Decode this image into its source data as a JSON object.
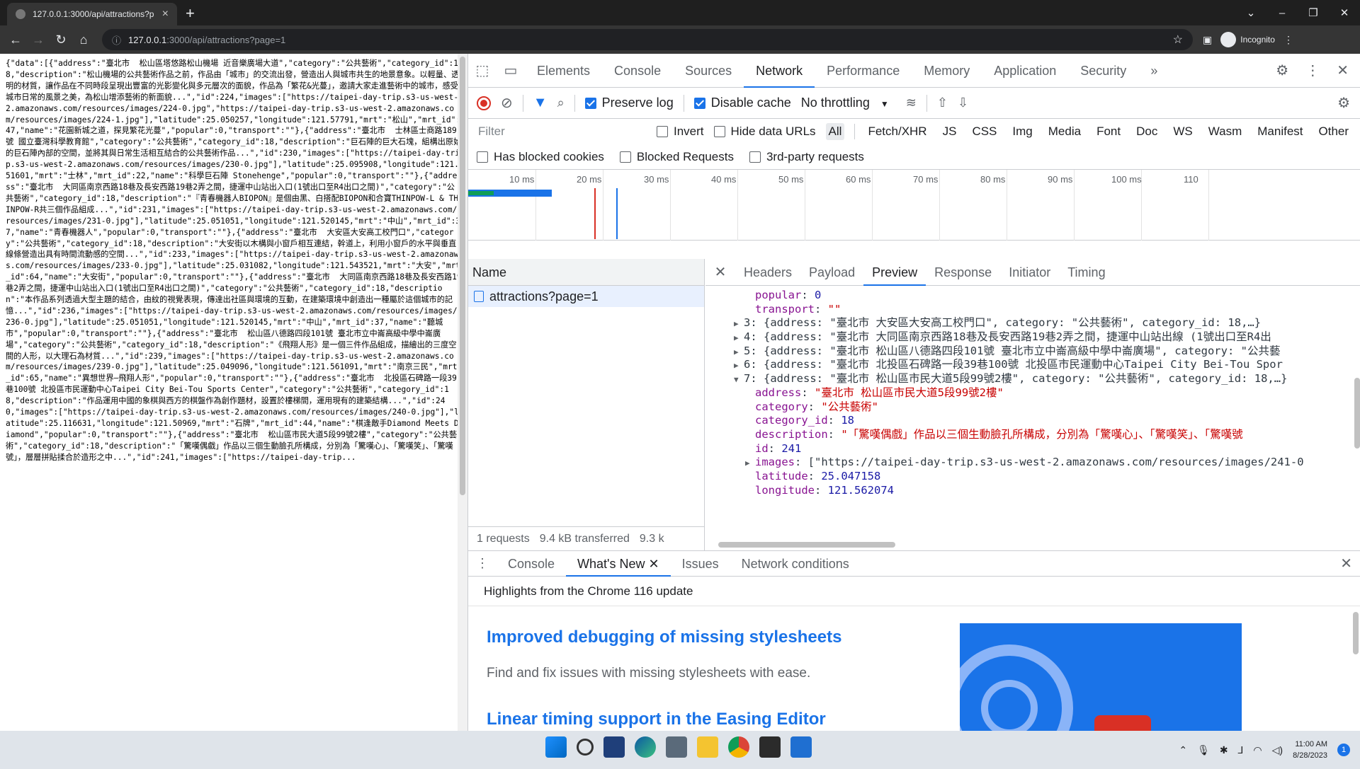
{
  "browser": {
    "tab_title": "127.0.0.1:3000/api/attractions?p",
    "url_host": "127.0.0.1",
    "url_path": ":3000/api/attractions?page=1",
    "profile_label": "Incognito"
  },
  "page": {
    "json_text": "{\"data\":[{\"address\":\"臺北市  松山區塔悠路松山機場 近音樂廣場大道\",\"category\":\"公共藝術\",\"category_id\":18,\"description\":\"松山機場的公共藝術作品之前，作品由「城市」的交流出發，營造出人與城市共生的地景意象。以輕量、透明的材質，讓作品在不同時段呈現出豐富的光影變化與多元層次的面貌，作品為「繁花&光蔓」，邀請大家走進藝術中的城市，感受城市日常的風景之美，為松山增添藝術的新面貌...\",\"id\":224,\"images\":[\"https://taipei-day-trip.s3-us-west-2.amazonaws.com/resources/images/224-0.jpg\",\"https://taipei-day-trip.s3-us-west-2.amazonaws.com/resources/images/224-1.jpg\"],\"latitude\":25.050257,\"longitude\":121.57791,\"mrt\":\"松山\",\"mrt_id\":47,\"name\":\"花園新城之道，探見繁花光蔓\",\"popular\":0,\"transport\":\"\"},{\"address\":\"臺北市  士林區士商路189號 國立臺灣科學教育館\",\"category\":\"公共藝術\",\"category_id\":18,\"description\":\"巨石陣的巨大石塊，組構出原始的巨石陣內部的空間，並將其與日常生活相互結合的公共藝術作品...\",\"id\":230,\"images\":[\"https://taipei-day-trip.s3-us-west-2.amazonaws.com/resources/images/230-0.jpg\"],\"latitude\":25.095908,\"longitude\":121.51601,\"mrt\":\"士林\",\"mrt_id\":22,\"name\":\"科學巨石陣 Stonehenge\",\"popular\":0,\"transport\":\"\"},{\"address\":\"臺北市  大同區南京西路18巷及長安西路19巷2弄之間，捷運中山站出入口(1號出口至R4出口之間)\",\"category\":\"公共藝術\",\"category_id\":18,\"description\":\"『青春機器人BIOPON』是個由黑、白搭配BIOPON和合寶THINPOW-L & THINPOW-R共三個作品組成...\",\"id\":231,\"images\":[\"https://taipei-day-trip.s3-us-west-2.amazonaws.com/resources/images/231-0.jpg\"],\"latitude\":25.051051,\"longitude\":121.520145,\"mrt\":\"中山\",\"mrt_id\":37,\"name\":\"青春機器人\",\"popular\":0,\"transport\":\"\"},{\"address\":\"臺北市  大安區大安高工校門口\",\"category\":\"公共藝術\",\"category_id\":18,\"description\":\"大安街以木構與小窗戶相互連結，幹道上，利用小窗戶的水平與垂直線條營造出具有時間流動感的空間...\",\"id\":233,\"images\":[\"https://taipei-day-trip.s3-us-west-2.amazonaws.com/resources/images/233-0.jpg\"],\"latitude\":25.031082,\"longitude\":121.543521,\"mrt\":\"大安\",\"mrt_id\":64,\"name\":\"大安街\",\"popular\":0,\"transport\":\"\"},{\"address\":\"臺北市  大同區南京西路18巷及長安西路19巷2弄之間，捷運中山站出入口(1號出口至R4出口之間)\",\"category\":\"公共藝術\",\"category_id\":18,\"description\":\"本作品系列透過大型主題的結合，由紋的視覺表現，傳達出社區與環境的互動，在建築環境中創造出一種屬於這個城市的記憶...\",\"id\":236,\"images\":[\"https://taipei-day-trip.s3-us-west-2.amazonaws.com/resources/images/236-0.jpg\"],\"latitude\":25.051051,\"longitude\":121.520145,\"mrt\":\"中山\",\"mrt_id\":37,\"name\":\"聽城市\",\"popular\":0,\"transport\":\"\"},{\"address\":\"臺北市  松山區八德路四段101號 臺北市立中崙高級中學中崙廣場\",\"category\":\"公共藝術\",\"category_id\":18,\"description\":\"《飛翔人形》是一個三件作品組成，描繪出的三度空間的人形，以大理石為材質...\",\"id\":239,\"images\":[\"https://taipei-day-trip.s3-us-west-2.amazonaws.com/resources/images/239-0.jpg\"],\"latitude\":25.049096,\"longitude\":121.561091,\"mrt\":\"南京三民\",\"mrt_id\":65,\"name\":\"異想世界—飛翔人形\",\"popular\":0,\"transport\":\"\"},{\"address\":\"臺北市  北投區石碑路一段39巷100號 北投區市民運動中心Taipei City Bei-Tou Sports Center\",\"category\":\"公共藝術\",\"category_id\":18,\"description\":\"作品運用中國的象棋與西方的棋盤作為創作題材，設置於樓梯間，運用現有的建築結構...\",\"id\":240,\"images\":[\"https://taipei-day-trip.s3-us-west-2.amazonaws.com/resources/images/240-0.jpg\"],\"latitude\":25.116631,\"longitude\":121.50969,\"mrt\":\"石牌\",\"mrt_id\":44,\"name\":\"棋逢敵手Diamond Meets Diamond\",\"popular\":0,\"transport\":\"\"},{\"address\":\"臺北市  松山區市民大道5段99號2樓\",\"category\":\"公共藝術\",\"category_id\":18,\"description\":\"「驚嘆偶戲」作品以三個生動臉孔所構成，分別為「驚嘆心」、「驚嘆笑」、「驚嘆號」，層層拼貼揉合於造形之中...\",\"id\":241,\"images\":[\"https://taipei-day-trip..."
  },
  "devtools": {
    "tabs": [
      "Elements",
      "Console",
      "Sources",
      "Network",
      "Performance",
      "Memory",
      "Application",
      "Security"
    ],
    "more": "»",
    "toolbar": {
      "preserve_log": "Preserve log",
      "disable_cache": "Disable cache",
      "throttling": "No throttling"
    },
    "filter": {
      "placeholder": "Filter",
      "invert": "Invert",
      "hide_data_urls": "Hide data URLs",
      "types": [
        "All",
        "Fetch/XHR",
        "JS",
        "CSS",
        "Img",
        "Media",
        "Font",
        "Doc",
        "WS",
        "Wasm",
        "Manifest",
        "Other"
      ]
    },
    "blocked": {
      "has_blocked_cookies": "Has blocked cookies",
      "blocked_requests": "Blocked Requests",
      "third_party": "3rd-party requests"
    },
    "timeline_ticks": [
      "10 ms",
      "20 ms",
      "30 ms",
      "40 ms",
      "50 ms",
      "60 ms",
      "70 ms",
      "80 ms",
      "90 ms",
      "100 ms",
      "110"
    ],
    "name_header": "Name",
    "request_name": "attractions?page=1",
    "status": {
      "requests": "1 requests",
      "transferred": "9.4 kB transferred",
      "resources": "9.3 k"
    },
    "detail_tabs": [
      "Headers",
      "Payload",
      "Preview",
      "Response",
      "Initiator",
      "Timing"
    ],
    "preview": {
      "popular_key": "popular",
      "popular_val": "0",
      "transport_key": "transport",
      "transport_val": "\"\"",
      "row3": "3: {address: \"臺北市 大安區大安高工校門口\", category: \"公共藝術\", category_id: 18,…}",
      "row4": "4: {address: \"臺北市 大同區南京西路18巷及長安西路19巷2弄之間，捷運中山站出線 (1號出口至R4出",
      "row5": "5: {address: \"臺北市 松山區八德路四段101號 臺北市立中崙高級中學中崙廣場\", category: \"公共藝",
      "row6": "6: {address: \"臺北市 北投區石碑路一段39巷100號 北投區市民運動中心Taipei City Bei-Tou Spor",
      "row7": "7: {address: \"臺北市 松山區市民大道5段99號2樓\", category: \"公共藝術\", category_id: 18,…}",
      "address_val": "\"臺北市  松山區市民大道5段99號2樓\"",
      "category_val": "\"公共藝術\"",
      "category_id_val": "18",
      "description_val": "\"「驚嘆偶戲」作品以三個生動臉孔所構成，分別為「驚嘆心」、「驚嘆笑」、「驚嘆號",
      "id_val": "241",
      "images_val": "[\"https://taipei-day-trip.s3-us-west-2.amazonaws.com/resources/images/241-0",
      "latitude_val": "25.047158",
      "longitude_val": "121.562074"
    },
    "drawer": {
      "tabs": [
        "Console",
        "What's New",
        "Issues",
        "Network conditions"
      ],
      "highlights": "Highlights from the Chrome 116 update",
      "title1": "Improved debugging of missing stylesheets",
      "desc1": "Find and fix issues with missing stylesheets with ease.",
      "title2": "Linear timing support in the Easing Editor"
    }
  },
  "taskbar": {
    "time": "11:00 AM",
    "date": "8/28/2023"
  },
  "colors": {
    "accent": "#1a73e8",
    "record": "#d93025",
    "key": "#881391",
    "string": "#c80000",
    "number": "#1a1aa6"
  }
}
